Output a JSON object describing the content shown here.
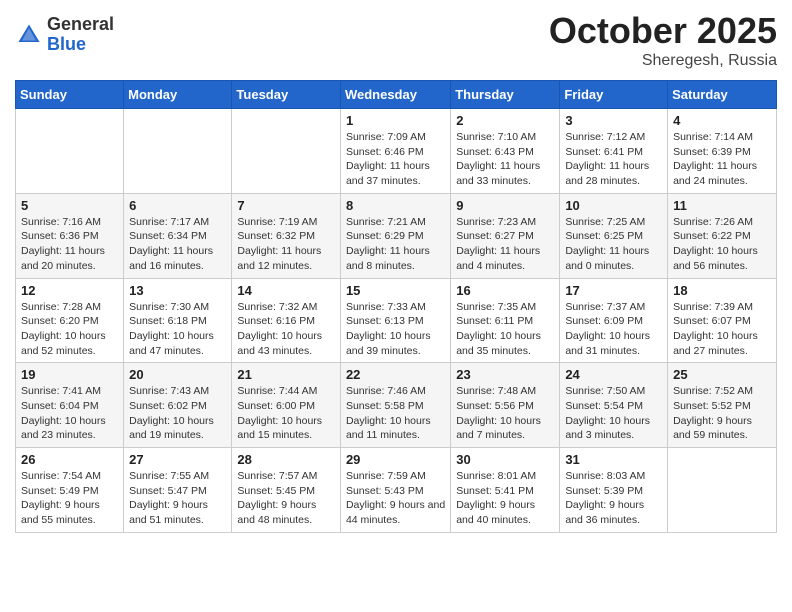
{
  "header": {
    "logo_general": "General",
    "logo_blue": "Blue",
    "month": "October 2025",
    "location": "Sheregesh, Russia"
  },
  "days_of_week": [
    "Sunday",
    "Monday",
    "Tuesday",
    "Wednesday",
    "Thursday",
    "Friday",
    "Saturday"
  ],
  "weeks": [
    [
      {
        "day": "",
        "sunrise": "",
        "sunset": "",
        "daylight": ""
      },
      {
        "day": "",
        "sunrise": "",
        "sunset": "",
        "daylight": ""
      },
      {
        "day": "",
        "sunrise": "",
        "sunset": "",
        "daylight": ""
      },
      {
        "day": "1",
        "sunrise": "Sunrise: 7:09 AM",
        "sunset": "Sunset: 6:46 PM",
        "daylight": "Daylight: 11 hours and 37 minutes."
      },
      {
        "day": "2",
        "sunrise": "Sunrise: 7:10 AM",
        "sunset": "Sunset: 6:43 PM",
        "daylight": "Daylight: 11 hours and 33 minutes."
      },
      {
        "day": "3",
        "sunrise": "Sunrise: 7:12 AM",
        "sunset": "Sunset: 6:41 PM",
        "daylight": "Daylight: 11 hours and 28 minutes."
      },
      {
        "day": "4",
        "sunrise": "Sunrise: 7:14 AM",
        "sunset": "Sunset: 6:39 PM",
        "daylight": "Daylight: 11 hours and 24 minutes."
      }
    ],
    [
      {
        "day": "5",
        "sunrise": "Sunrise: 7:16 AM",
        "sunset": "Sunset: 6:36 PM",
        "daylight": "Daylight: 11 hours and 20 minutes."
      },
      {
        "day": "6",
        "sunrise": "Sunrise: 7:17 AM",
        "sunset": "Sunset: 6:34 PM",
        "daylight": "Daylight: 11 hours and 16 minutes."
      },
      {
        "day": "7",
        "sunrise": "Sunrise: 7:19 AM",
        "sunset": "Sunset: 6:32 PM",
        "daylight": "Daylight: 11 hours and 12 minutes."
      },
      {
        "day": "8",
        "sunrise": "Sunrise: 7:21 AM",
        "sunset": "Sunset: 6:29 PM",
        "daylight": "Daylight: 11 hours and 8 minutes."
      },
      {
        "day": "9",
        "sunrise": "Sunrise: 7:23 AM",
        "sunset": "Sunset: 6:27 PM",
        "daylight": "Daylight: 11 hours and 4 minutes."
      },
      {
        "day": "10",
        "sunrise": "Sunrise: 7:25 AM",
        "sunset": "Sunset: 6:25 PM",
        "daylight": "Daylight: 11 hours and 0 minutes."
      },
      {
        "day": "11",
        "sunrise": "Sunrise: 7:26 AM",
        "sunset": "Sunset: 6:22 PM",
        "daylight": "Daylight: 10 hours and 56 minutes."
      }
    ],
    [
      {
        "day": "12",
        "sunrise": "Sunrise: 7:28 AM",
        "sunset": "Sunset: 6:20 PM",
        "daylight": "Daylight: 10 hours and 52 minutes."
      },
      {
        "day": "13",
        "sunrise": "Sunrise: 7:30 AM",
        "sunset": "Sunset: 6:18 PM",
        "daylight": "Daylight: 10 hours and 47 minutes."
      },
      {
        "day": "14",
        "sunrise": "Sunrise: 7:32 AM",
        "sunset": "Sunset: 6:16 PM",
        "daylight": "Daylight: 10 hours and 43 minutes."
      },
      {
        "day": "15",
        "sunrise": "Sunrise: 7:33 AM",
        "sunset": "Sunset: 6:13 PM",
        "daylight": "Daylight: 10 hours and 39 minutes."
      },
      {
        "day": "16",
        "sunrise": "Sunrise: 7:35 AM",
        "sunset": "Sunset: 6:11 PM",
        "daylight": "Daylight: 10 hours and 35 minutes."
      },
      {
        "day": "17",
        "sunrise": "Sunrise: 7:37 AM",
        "sunset": "Sunset: 6:09 PM",
        "daylight": "Daylight: 10 hours and 31 minutes."
      },
      {
        "day": "18",
        "sunrise": "Sunrise: 7:39 AM",
        "sunset": "Sunset: 6:07 PM",
        "daylight": "Daylight: 10 hours and 27 minutes."
      }
    ],
    [
      {
        "day": "19",
        "sunrise": "Sunrise: 7:41 AM",
        "sunset": "Sunset: 6:04 PM",
        "daylight": "Daylight: 10 hours and 23 minutes."
      },
      {
        "day": "20",
        "sunrise": "Sunrise: 7:43 AM",
        "sunset": "Sunset: 6:02 PM",
        "daylight": "Daylight: 10 hours and 19 minutes."
      },
      {
        "day": "21",
        "sunrise": "Sunrise: 7:44 AM",
        "sunset": "Sunset: 6:00 PM",
        "daylight": "Daylight: 10 hours and 15 minutes."
      },
      {
        "day": "22",
        "sunrise": "Sunrise: 7:46 AM",
        "sunset": "Sunset: 5:58 PM",
        "daylight": "Daylight: 10 hours and 11 minutes."
      },
      {
        "day": "23",
        "sunrise": "Sunrise: 7:48 AM",
        "sunset": "Sunset: 5:56 PM",
        "daylight": "Daylight: 10 hours and 7 minutes."
      },
      {
        "day": "24",
        "sunrise": "Sunrise: 7:50 AM",
        "sunset": "Sunset: 5:54 PM",
        "daylight": "Daylight: 10 hours and 3 minutes."
      },
      {
        "day": "25",
        "sunrise": "Sunrise: 7:52 AM",
        "sunset": "Sunset: 5:52 PM",
        "daylight": "Daylight: 9 hours and 59 minutes."
      }
    ],
    [
      {
        "day": "26",
        "sunrise": "Sunrise: 7:54 AM",
        "sunset": "Sunset: 5:49 PM",
        "daylight": "Daylight: 9 hours and 55 minutes."
      },
      {
        "day": "27",
        "sunrise": "Sunrise: 7:55 AM",
        "sunset": "Sunset: 5:47 PM",
        "daylight": "Daylight: 9 hours and 51 minutes."
      },
      {
        "day": "28",
        "sunrise": "Sunrise: 7:57 AM",
        "sunset": "Sunset: 5:45 PM",
        "daylight": "Daylight: 9 hours and 48 minutes."
      },
      {
        "day": "29",
        "sunrise": "Sunrise: 7:59 AM",
        "sunset": "Sunset: 5:43 PM",
        "daylight": "Daylight: 9 hours and 44 minutes."
      },
      {
        "day": "30",
        "sunrise": "Sunrise: 8:01 AM",
        "sunset": "Sunset: 5:41 PM",
        "daylight": "Daylight: 9 hours and 40 minutes."
      },
      {
        "day": "31",
        "sunrise": "Sunrise: 8:03 AM",
        "sunset": "Sunset: 5:39 PM",
        "daylight": "Daylight: 9 hours and 36 minutes."
      },
      {
        "day": "",
        "sunrise": "",
        "sunset": "",
        "daylight": ""
      }
    ]
  ]
}
